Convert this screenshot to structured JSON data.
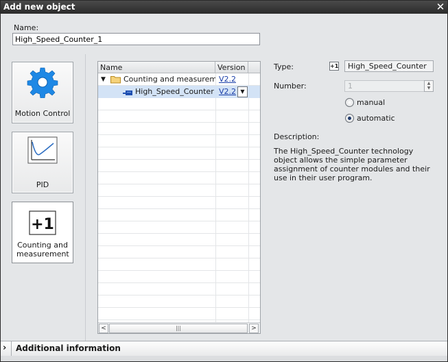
{
  "window": {
    "title": "Add new object",
    "close_glyph": "✕"
  },
  "name_field": {
    "label": "Name:",
    "value": "High_Speed_Counter_1"
  },
  "categories": [
    {
      "label": "Motion Control",
      "icon": "gear-icon"
    },
    {
      "label": "PID",
      "icon": "pid-curve-icon"
    },
    {
      "label": "Counting and measurement",
      "icon": "plus-one-icon",
      "selected": true
    }
  ],
  "tree": {
    "columns": {
      "name": "Name",
      "version": "Version"
    },
    "rows": [
      {
        "name": "Counting and measurem...",
        "version": "V2.2",
        "kind": "folder",
        "expanded": true
      },
      {
        "name": "High_Speed_Counter",
        "version": "V2.2",
        "kind": "object",
        "selected": true
      }
    ],
    "scroll_thumb_glyph": "|||"
  },
  "details": {
    "type_label": "Type:",
    "type_badge": "+1",
    "type_value": "High_Speed_Counter",
    "number_label": "Number:",
    "number_value": "1",
    "radio_manual": "manual",
    "radio_automatic": "automatic",
    "selected_radio": "automatic",
    "description_label": "Description:",
    "description_text": "The High_Speed_Counter technology object allows the simple parameter assignment of counter modules and their use in their user program."
  },
  "footer": {
    "additional_info_label": "Additional  information"
  },
  "colors": {
    "title_bar": "#2b2b2b",
    "selection": "#d3e3f6",
    "link": "#1a3ea8",
    "gear": "#1e88e5"
  }
}
